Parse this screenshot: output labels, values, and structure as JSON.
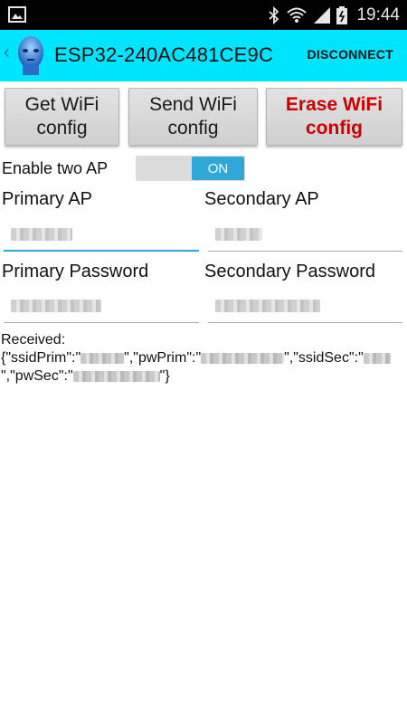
{
  "status_bar": {
    "time": "19:44",
    "icons": [
      "image-icon",
      "bluetooth-icon",
      "wifi-icon",
      "signal-icon",
      "battery-icon"
    ]
  },
  "action_bar": {
    "title": "ESP32-240AC481CE9C",
    "disconnect_label": "DISCONNECT",
    "accent_color": "#00e5ff"
  },
  "buttons": {
    "get_wifi": "Get WiFi\nconfig",
    "send_wifi": "Send WiFi\nconfig",
    "erase_wifi": "Erase WiFi\nconfig",
    "erase_color": "#cc0000"
  },
  "enable_two_ap": {
    "label": "Enable two AP",
    "toggle_state": "ON",
    "toggle_color": "#2fa8d8"
  },
  "fields": {
    "primary_ap_label": "Primary AP",
    "secondary_ap_label": "Secondary AP",
    "primary_password_label": "Primary Password",
    "secondary_password_label": "Secondary Password"
  },
  "received": {
    "label": "Received:",
    "line1_part1": "{\"ssidPrim\":\"",
    "line1_part2": "\",\"pwPrim\":\"",
    "line1_part3": "\",\"ssidSec\":\"",
    "line2_part1": "\",\"pwSec\":\"",
    "line2_part2": "\"}"
  }
}
